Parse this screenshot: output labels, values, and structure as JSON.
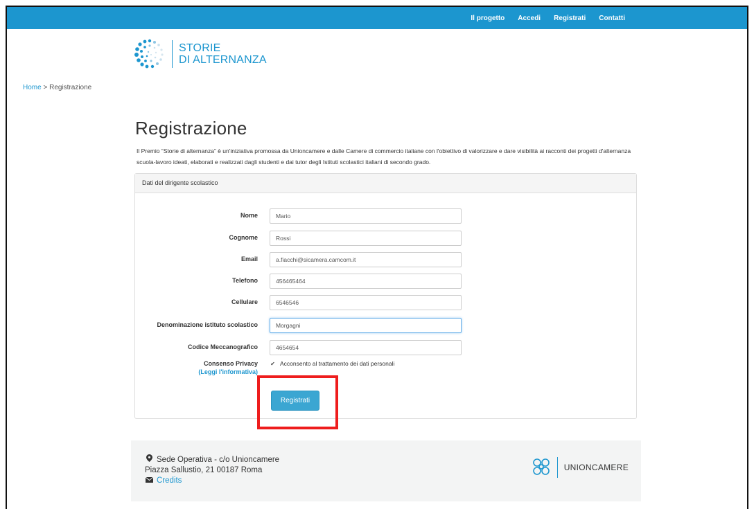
{
  "nav": {
    "items": [
      "Il progetto",
      "Accedi",
      "Registrati",
      "Contatti"
    ]
  },
  "logo": {
    "line1": "STORIE",
    "line2": "DI ALTERNANZA"
  },
  "breadcrumb": {
    "home": "Home",
    "separator": ">",
    "current": "Registrazione"
  },
  "page": {
    "title": "Registrazione",
    "intro": "Il Premio “Storie di alternanza” è un'iniziativa promossa da Unioncamere e dalle Camere di commercio italiane con l'obiettivo di valorizzare e dare visibilità ai racconti dei progetti d'alternanza scuola-lavoro ideati, elaborati e realizzati dagli studenti e dai tutor degli Istituti scolastici italiani di secondo grado."
  },
  "panel": {
    "heading": "Dati del dirigente scolastico"
  },
  "form": {
    "fields": [
      {
        "label": "Nome",
        "value": "Mario"
      },
      {
        "label": "Cognome",
        "value": "Rossi"
      },
      {
        "label": "Email",
        "value": "a.fiacchi@sicamera.camcom.it"
      },
      {
        "label": "Telefono",
        "value": "456465464"
      },
      {
        "label": "Cellulare",
        "value": "6546546"
      },
      {
        "label": "Denominazione istituto scolastico",
        "value": "Morgagni"
      },
      {
        "label": "Codice Meccanografico",
        "value": "4654654"
      }
    ],
    "privacy_label": "Consenso Privacy",
    "privacy_link": "(Leggi l'informativa)",
    "privacy_checkbox_label": "Acconsento al trattamento dei dati personali",
    "privacy_checked": true,
    "submit_label": "Registrati"
  },
  "footer": {
    "address_line1": "Sede Operativa - c/o Unioncamere",
    "address_line2": "Piazza Sallustio, 21 00187 Roma",
    "credits": "Credits",
    "brand": "UNIONCAMERE"
  },
  "colors": {
    "accent": "#1c96cf",
    "button": "#3ba6d2",
    "highlight": "#ee1d1d",
    "footer_bg": "#f3f4f4"
  },
  "icons": {
    "location": "map-marker-icon",
    "mail": "envelope-icon",
    "logo": "dots-circle-logo-icon",
    "brand_logo": "unioncamere-knot-icon"
  }
}
